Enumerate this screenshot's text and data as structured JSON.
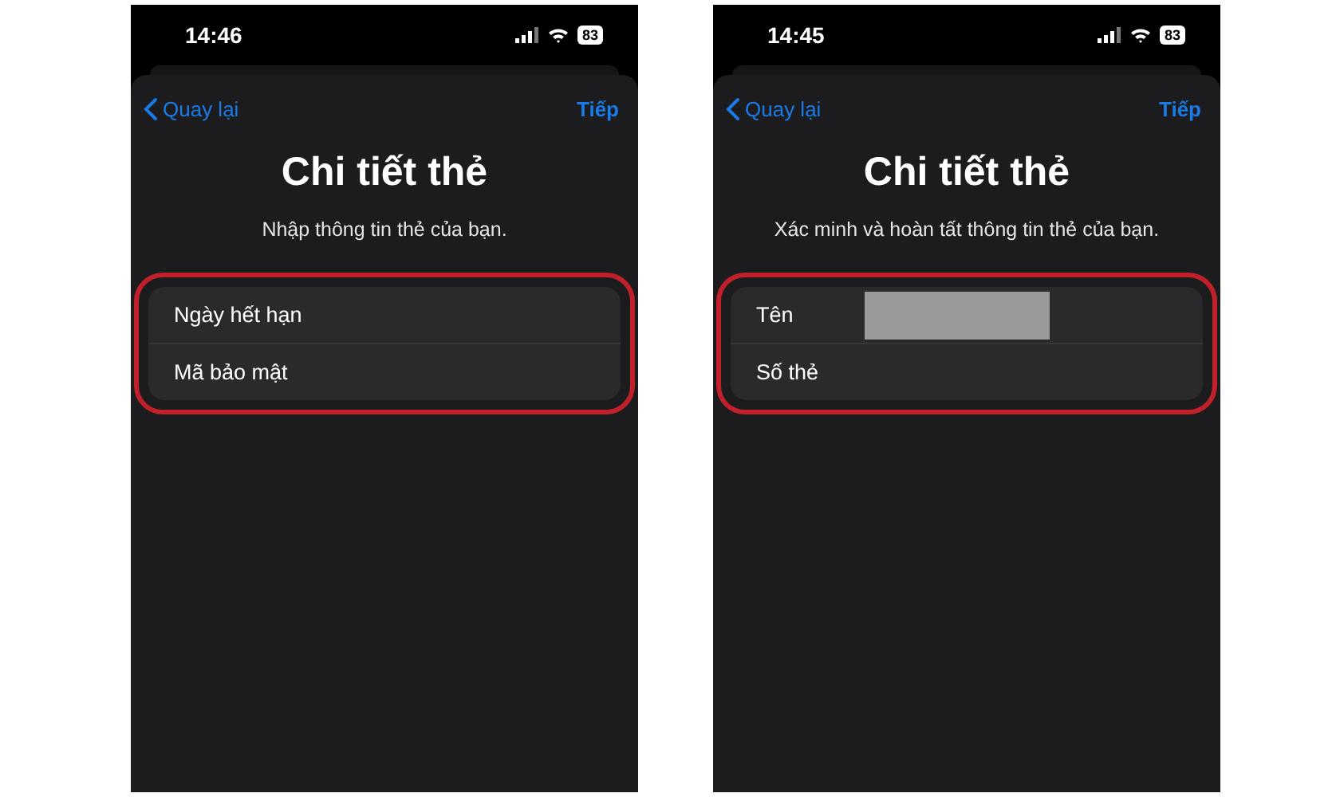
{
  "screens": [
    {
      "status_bar": {
        "time": "14:46",
        "battery": "83"
      },
      "nav": {
        "back": "Quay lại",
        "next": "Tiếp"
      },
      "title": "Chi tiết thẻ",
      "subtitle": "Nhập thông tin thẻ của bạn.",
      "highlighted": true,
      "fields": [
        {
          "label": "Ngày hết hạn",
          "redacted": false
        },
        {
          "label": "Mã bảo mật",
          "redacted": false
        }
      ]
    },
    {
      "status_bar": {
        "time": "14:45",
        "battery": "83"
      },
      "nav": {
        "back": "Quay lại",
        "next": "Tiếp"
      },
      "title": "Chi tiết thẻ",
      "subtitle": "Xác minh và hoàn tất thông tin thẻ của bạn.",
      "highlighted": true,
      "fields": [
        {
          "label": "Tên",
          "redacted": true
        },
        {
          "label": "Số thẻ",
          "redacted": false
        }
      ]
    }
  ]
}
